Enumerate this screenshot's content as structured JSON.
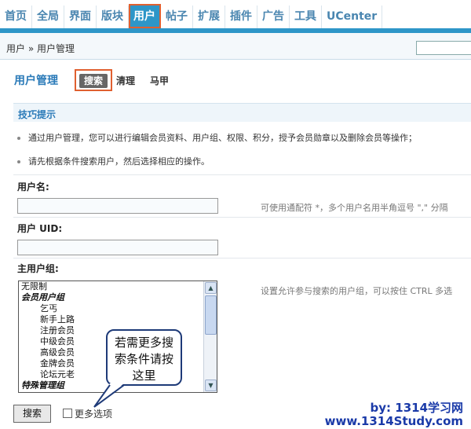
{
  "nav": {
    "items": [
      "首页",
      "全局",
      "界面",
      "版块",
      "用户",
      "帖子",
      "扩展",
      "插件",
      "广告",
      "工具",
      "UCenter"
    ],
    "active_index": 4
  },
  "breadcrumb": "用户 » 用户管理",
  "page": {
    "title": "用户管理",
    "tabs": [
      "搜索",
      "清理",
      "马甲"
    ],
    "active_tab": "搜索"
  },
  "tips": {
    "title": "技巧提示",
    "items": [
      "通过用户管理，您可以进行编辑会员资料、用户组、权限、积分，授予会员勋章以及删除会员等操作；",
      "请先根据条件搜索用户，然后选择相应的操作。"
    ]
  },
  "form": {
    "username_label": "用户名:",
    "username_value": "",
    "username_hint": "可使用通配符 *，多个用户名用半角逗号 \",\" 分隔",
    "uid_label": "用户  UID:",
    "uid_value": "",
    "group_label": "主用户组:",
    "group_hint": "设置允许参与搜索的用户组，可以按住 CTRL 多选",
    "group_options": [
      {
        "text": "无限制",
        "kind": "opt"
      },
      {
        "text": "会员用户组",
        "kind": "grp"
      },
      {
        "text": "乞丐",
        "kind": "sub"
      },
      {
        "text": "新手上路",
        "kind": "sub"
      },
      {
        "text": "注册会员",
        "kind": "sub"
      },
      {
        "text": "中级会员",
        "kind": "sub"
      },
      {
        "text": "高级会员",
        "kind": "sub"
      },
      {
        "text": "金牌会员",
        "kind": "sub"
      },
      {
        "text": "论坛元老",
        "kind": "sub"
      },
      {
        "text": "特殊管理组",
        "kind": "grp"
      }
    ],
    "search_button": "搜索",
    "more_options_label": "更多选项"
  },
  "callout": {
    "lines": [
      "若需更多搜",
      "索条件请按",
      "这里"
    ]
  },
  "watermark": {
    "line1": "by: 1314学习网",
    "line2": "www.1314Study.com",
    "color": "#1a3aa8"
  },
  "colors": {
    "nav_bar": "#2e96c8",
    "highlight_border": "#e06030",
    "title_blue": "#2a7ab8"
  }
}
